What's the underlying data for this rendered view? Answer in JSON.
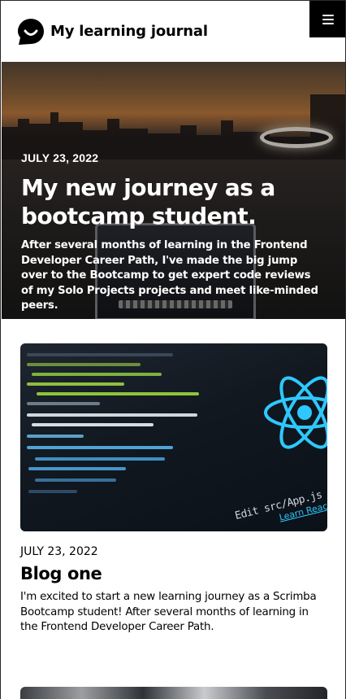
{
  "header": {
    "site_title": "My learning journal",
    "logo_icon": "chat-bubble-smile-icon",
    "menu_icon": "hamburger-menu-icon"
  },
  "hero": {
    "date": "JULY 23, 2022",
    "title": "My new journey as a bootcamp student.",
    "text": "After several months of learning in the Frontend Developer Career Path, I've made the big jump over to the Bootcamp to get expert code reviews of my Solo Projects projects and meet like-minded peers."
  },
  "posts": [
    {
      "date": "JULY 23, 2022",
      "title": "Blog one",
      "text": "I'm excited to start a new learning journey as a Scrimba Bootcamp student! After several months of learning in the Frontend Developer Career Path.",
      "image": {
        "caption": "Edit src/App.js and save",
        "link": "Learn React"
      }
    }
  ],
  "colors": {
    "header_bg": "#ffffff",
    "menu_bg": "#000000",
    "text": "#000000",
    "hero_text": "#ffffff",
    "react_accent": "#2ec8ff"
  }
}
